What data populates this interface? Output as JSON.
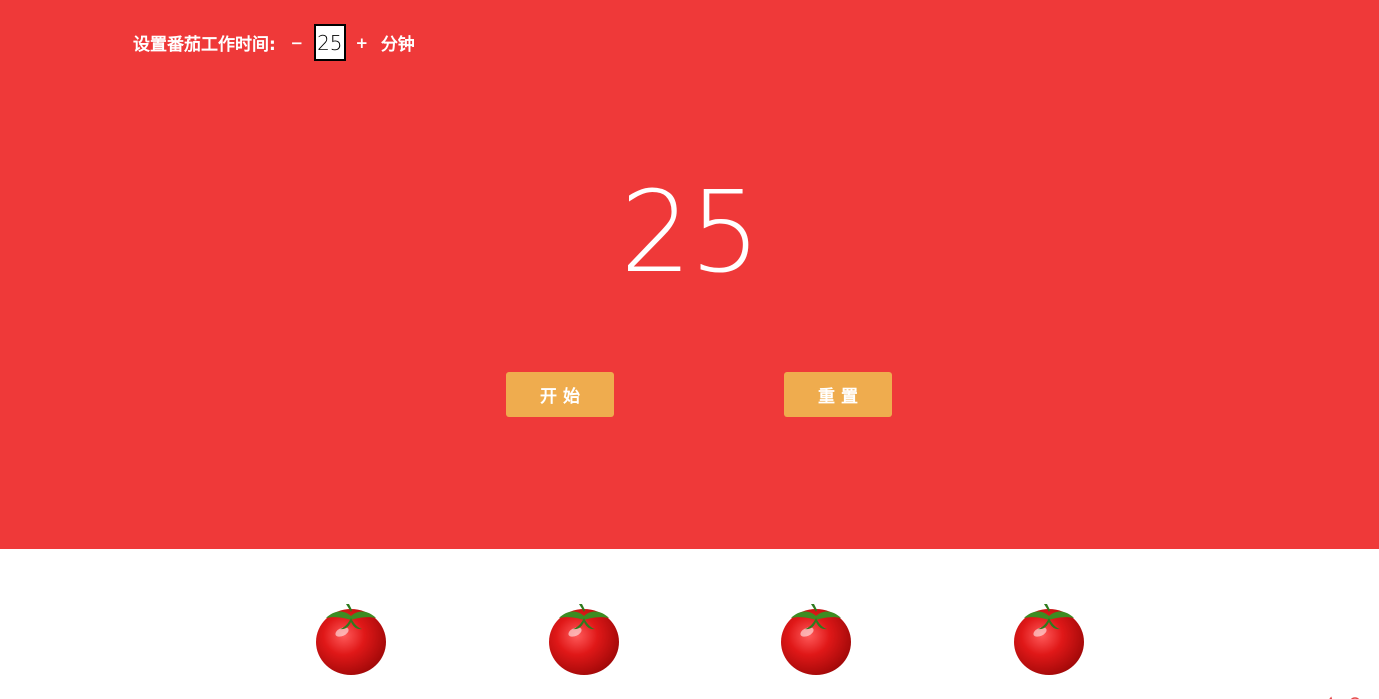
{
  "settings": {
    "label": "设置番茄工作时间:",
    "decrement": "−",
    "minutes_value": "25",
    "increment": "+",
    "unit": "分钟"
  },
  "timer": {
    "display": "25"
  },
  "controls": {
    "start_label": "开始",
    "reset_label": "重置"
  },
  "pomodoros": {
    "count": 4,
    "icon": "tomato-icon"
  },
  "colors": {
    "background_red": "#ef3939",
    "button_orange": "#efac4e",
    "text_white": "#ffffff",
    "bottom_white": "#ffffff"
  }
}
